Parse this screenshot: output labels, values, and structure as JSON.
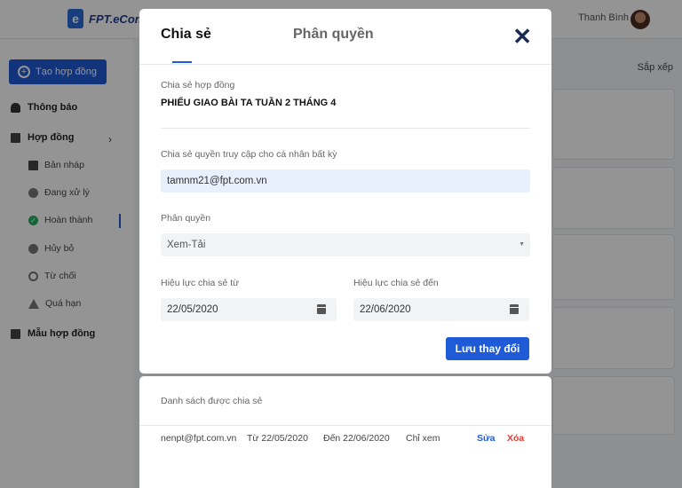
{
  "app": {
    "logo_text": "FPT.eContract",
    "user_name": "Thanh Bình",
    "sort_label": "Sắp xếp"
  },
  "sidebar": {
    "create_label": "Tạo hợp đồng",
    "notifications_label": "Thông báo",
    "contracts_label": "Hợp đồng",
    "items": [
      {
        "label": "Bản nháp",
        "icon": "document-icon"
      },
      {
        "label": "Đang xử lý",
        "icon": "arrow-circle-icon"
      },
      {
        "label": "Hoàn thành",
        "icon": "check-circle-icon"
      },
      {
        "label": "Hủy bỏ",
        "icon": "x-circle-icon"
      },
      {
        "label": "Từ chối",
        "icon": "ban-icon"
      },
      {
        "label": "Quá hạn",
        "icon": "warning-icon"
      }
    ],
    "templates_label": "Mẫu hợp đồng"
  },
  "modal": {
    "tab_share": "Chia sẻ",
    "tab_permission": "Phân quyền",
    "doc_label": "Chia sẻ hợp đồng",
    "doc_title": "PHIẾU GIAO BÀI TA TUẦN 2 THÁNG 4",
    "access_label": "Chia sẻ quyền truy cập cho cá nhân bất kỳ",
    "email_value": "tamnm21@fpt.com.vn",
    "permission_label": "Phân quyền",
    "permission_value": "Xem-Tải",
    "valid_from_label": "Hiệu lực chia sẻ từ",
    "valid_from_value": "22/05/2020",
    "valid_to_label": "Hiệu lực chia sẻ đến",
    "valid_to_value": "22/06/2020",
    "save_label": "Lưu thay đổi"
  },
  "shared_list": {
    "title": "Danh sách được chia sẻ",
    "rows": [
      {
        "email": "nenpt@fpt.com.vn",
        "from": "Từ 22/05/2020",
        "to": "Đến 22/06/2020",
        "permission": "Chỉ xem",
        "edit": "Sửa",
        "delete": "Xóa"
      }
    ]
  }
}
